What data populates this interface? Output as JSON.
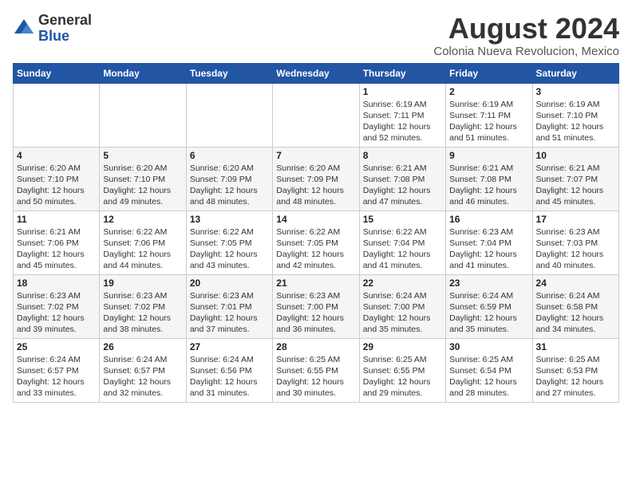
{
  "header": {
    "logo_general": "General",
    "logo_blue": "Blue",
    "month_year": "August 2024",
    "location": "Colonia Nueva Revolucion, Mexico"
  },
  "weekdays": [
    "Sunday",
    "Monday",
    "Tuesday",
    "Wednesday",
    "Thursday",
    "Friday",
    "Saturday"
  ],
  "weeks": [
    [
      {
        "day": "",
        "info": ""
      },
      {
        "day": "",
        "info": ""
      },
      {
        "day": "",
        "info": ""
      },
      {
        "day": "",
        "info": ""
      },
      {
        "day": "1",
        "info": "Sunrise: 6:19 AM\nSunset: 7:11 PM\nDaylight: 12 hours\nand 52 minutes."
      },
      {
        "day": "2",
        "info": "Sunrise: 6:19 AM\nSunset: 7:11 PM\nDaylight: 12 hours\nand 51 minutes."
      },
      {
        "day": "3",
        "info": "Sunrise: 6:19 AM\nSunset: 7:10 PM\nDaylight: 12 hours\nand 51 minutes."
      }
    ],
    [
      {
        "day": "4",
        "info": "Sunrise: 6:20 AM\nSunset: 7:10 PM\nDaylight: 12 hours\nand 50 minutes."
      },
      {
        "day": "5",
        "info": "Sunrise: 6:20 AM\nSunset: 7:10 PM\nDaylight: 12 hours\nand 49 minutes."
      },
      {
        "day": "6",
        "info": "Sunrise: 6:20 AM\nSunset: 7:09 PM\nDaylight: 12 hours\nand 48 minutes."
      },
      {
        "day": "7",
        "info": "Sunrise: 6:20 AM\nSunset: 7:09 PM\nDaylight: 12 hours\nand 48 minutes."
      },
      {
        "day": "8",
        "info": "Sunrise: 6:21 AM\nSunset: 7:08 PM\nDaylight: 12 hours\nand 47 minutes."
      },
      {
        "day": "9",
        "info": "Sunrise: 6:21 AM\nSunset: 7:08 PM\nDaylight: 12 hours\nand 46 minutes."
      },
      {
        "day": "10",
        "info": "Sunrise: 6:21 AM\nSunset: 7:07 PM\nDaylight: 12 hours\nand 45 minutes."
      }
    ],
    [
      {
        "day": "11",
        "info": "Sunrise: 6:21 AM\nSunset: 7:06 PM\nDaylight: 12 hours\nand 45 minutes."
      },
      {
        "day": "12",
        "info": "Sunrise: 6:22 AM\nSunset: 7:06 PM\nDaylight: 12 hours\nand 44 minutes."
      },
      {
        "day": "13",
        "info": "Sunrise: 6:22 AM\nSunset: 7:05 PM\nDaylight: 12 hours\nand 43 minutes."
      },
      {
        "day": "14",
        "info": "Sunrise: 6:22 AM\nSunset: 7:05 PM\nDaylight: 12 hours\nand 42 minutes."
      },
      {
        "day": "15",
        "info": "Sunrise: 6:22 AM\nSunset: 7:04 PM\nDaylight: 12 hours\nand 41 minutes."
      },
      {
        "day": "16",
        "info": "Sunrise: 6:23 AM\nSunset: 7:04 PM\nDaylight: 12 hours\nand 41 minutes."
      },
      {
        "day": "17",
        "info": "Sunrise: 6:23 AM\nSunset: 7:03 PM\nDaylight: 12 hours\nand 40 minutes."
      }
    ],
    [
      {
        "day": "18",
        "info": "Sunrise: 6:23 AM\nSunset: 7:02 PM\nDaylight: 12 hours\nand 39 minutes."
      },
      {
        "day": "19",
        "info": "Sunrise: 6:23 AM\nSunset: 7:02 PM\nDaylight: 12 hours\nand 38 minutes."
      },
      {
        "day": "20",
        "info": "Sunrise: 6:23 AM\nSunset: 7:01 PM\nDaylight: 12 hours\nand 37 minutes."
      },
      {
        "day": "21",
        "info": "Sunrise: 6:23 AM\nSunset: 7:00 PM\nDaylight: 12 hours\nand 36 minutes."
      },
      {
        "day": "22",
        "info": "Sunrise: 6:24 AM\nSunset: 7:00 PM\nDaylight: 12 hours\nand 35 minutes."
      },
      {
        "day": "23",
        "info": "Sunrise: 6:24 AM\nSunset: 6:59 PM\nDaylight: 12 hours\nand 35 minutes."
      },
      {
        "day": "24",
        "info": "Sunrise: 6:24 AM\nSunset: 6:58 PM\nDaylight: 12 hours\nand 34 minutes."
      }
    ],
    [
      {
        "day": "25",
        "info": "Sunrise: 6:24 AM\nSunset: 6:57 PM\nDaylight: 12 hours\nand 33 minutes."
      },
      {
        "day": "26",
        "info": "Sunrise: 6:24 AM\nSunset: 6:57 PM\nDaylight: 12 hours\nand 32 minutes."
      },
      {
        "day": "27",
        "info": "Sunrise: 6:24 AM\nSunset: 6:56 PM\nDaylight: 12 hours\nand 31 minutes."
      },
      {
        "day": "28",
        "info": "Sunrise: 6:25 AM\nSunset: 6:55 PM\nDaylight: 12 hours\nand 30 minutes."
      },
      {
        "day": "29",
        "info": "Sunrise: 6:25 AM\nSunset: 6:55 PM\nDaylight: 12 hours\nand 29 minutes."
      },
      {
        "day": "30",
        "info": "Sunrise: 6:25 AM\nSunset: 6:54 PM\nDaylight: 12 hours\nand 28 minutes."
      },
      {
        "day": "31",
        "info": "Sunrise: 6:25 AM\nSunset: 6:53 PM\nDaylight: 12 hours\nand 27 minutes."
      }
    ]
  ]
}
